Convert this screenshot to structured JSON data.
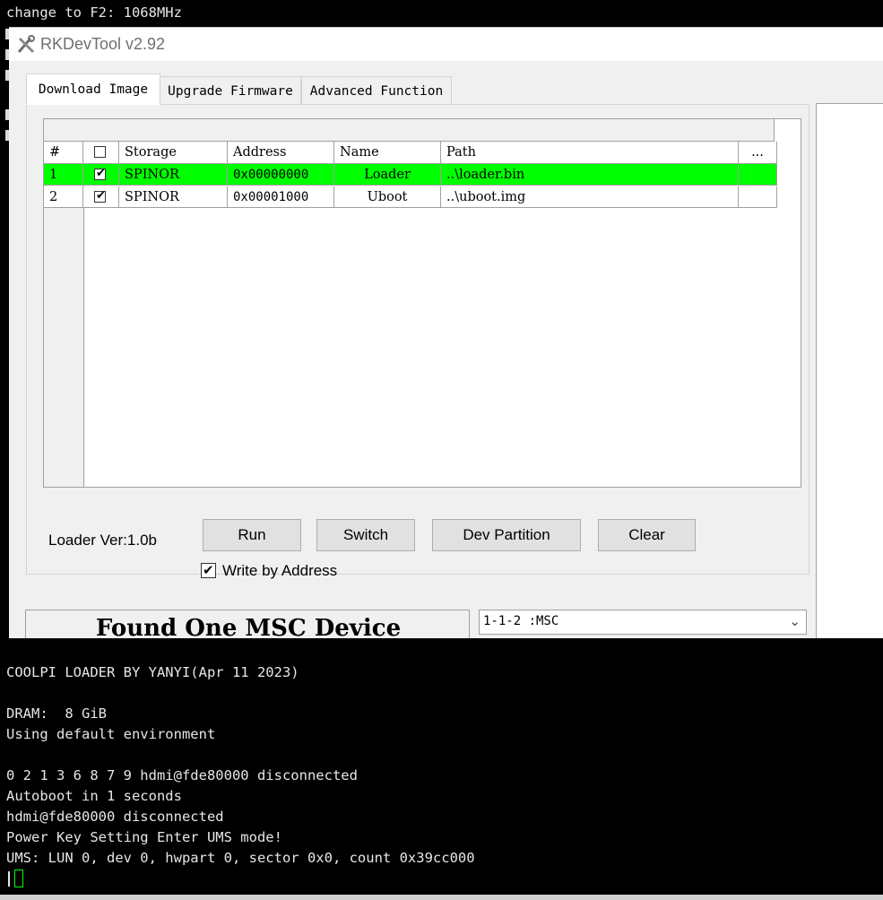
{
  "terminal_top": {
    "line": "change to F2: 1068MHz"
  },
  "window": {
    "title": "RKDevTool v2.92",
    "icon": "tools-icon"
  },
  "tabs": [
    {
      "label": "Download Image"
    },
    {
      "label": "Upgrade Firmware"
    },
    {
      "label": "Advanced Function"
    }
  ],
  "grid": {
    "columns": [
      "#",
      "",
      "Storage",
      "Address",
      "Name",
      "Path",
      "..."
    ],
    "rows": [
      {
        "index": "1",
        "checked": true,
        "storage": "SPINOR",
        "address": "0x00000000",
        "name": "Loader",
        "path": "..\\loader.bin",
        "highlight_color": "#00ff00"
      },
      {
        "index": "2",
        "checked": true,
        "storage": "SPINOR",
        "address": "0x00001000",
        "name": "Uboot",
        "path": "..\\uboot.img",
        "highlight_color": "#ffffff"
      }
    ]
  },
  "controls": {
    "loader_version": "Loader Ver:1.0b",
    "run_label": "Run",
    "switch_label": "Switch",
    "dev_partition_label": "Dev Partition",
    "clear_label": "Clear",
    "write_by_address_label": "Write by Address",
    "write_by_address_checked": true
  },
  "status": {
    "message": "Found One MSC Device",
    "device_selected": "1-1-2 :MSC"
  },
  "terminal_bottom": {
    "lines": [
      "COOLPI LOADER BY YANYI(Apr 11 2023)",
      "",
      "DRAM:  8 GiB",
      "Using default environment",
      "",
      "0 2 1 3 6 8 7 9 hdmi@fde80000 disconnected",
      "Autoboot in 1 seconds",
      "hdmi@fde80000 disconnected",
      "Power Key Setting Enter UMS mode!",
      "UMS: LUN 0, dev 0, hwpart 0, sector 0x0, count 0x39cc000"
    ],
    "cursor_color": "#00ff00"
  }
}
